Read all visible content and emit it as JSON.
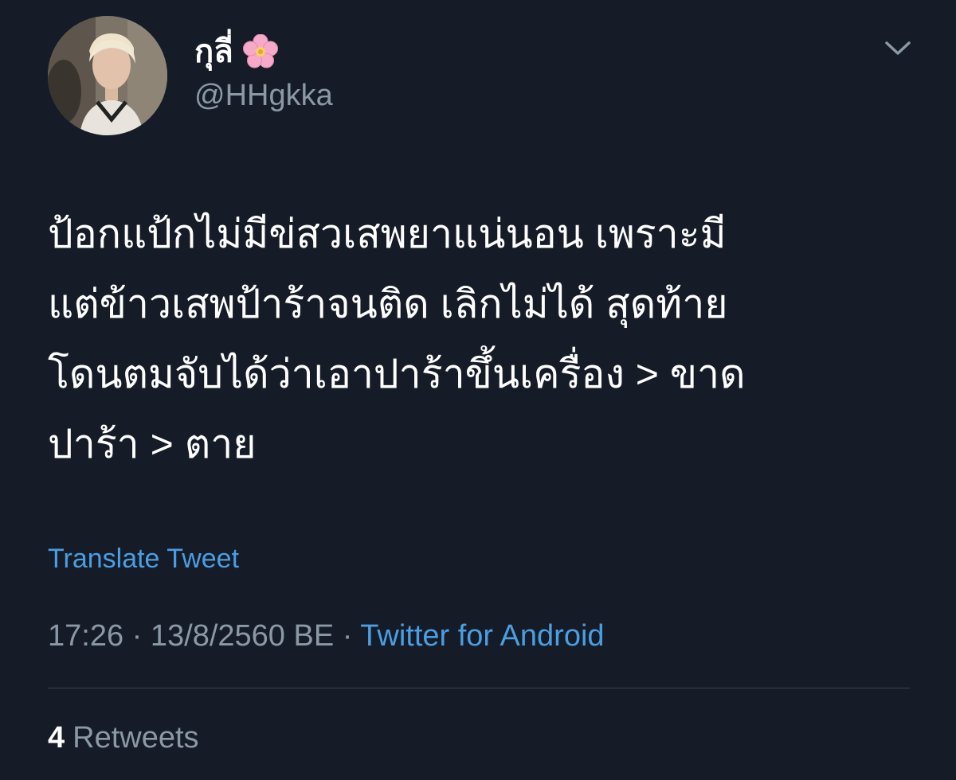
{
  "author": {
    "display_name": "กุลี่",
    "handle": "@HHgkka",
    "emoji_icon": "cherry-blossom-icon"
  },
  "tweet": {
    "lines": [
      "ป้อกแป้กไม่มีข่สวเสพยาแน่นอน เพราะมี",
      "แต่ข้าวเสพป้าร้าจนติด เลิกไม่ได้ สุดท้าย",
      "โดนตมจับได้ว่าเอาปาร้าขึ้นเครื่อง > ขาด",
      "ปาร้า > ตาย"
    ],
    "translate_label": "Translate Tweet"
  },
  "meta": {
    "time": "17:26",
    "separator": " · ",
    "date": "13/8/2560 BE",
    "source": "Twitter for Android"
  },
  "stats": {
    "retweets_count": "4",
    "retweets_label": "Retweets"
  },
  "colors": {
    "background": "#151c27",
    "link": "#4a9ee3",
    "secondary_text": "#8b98a5"
  }
}
